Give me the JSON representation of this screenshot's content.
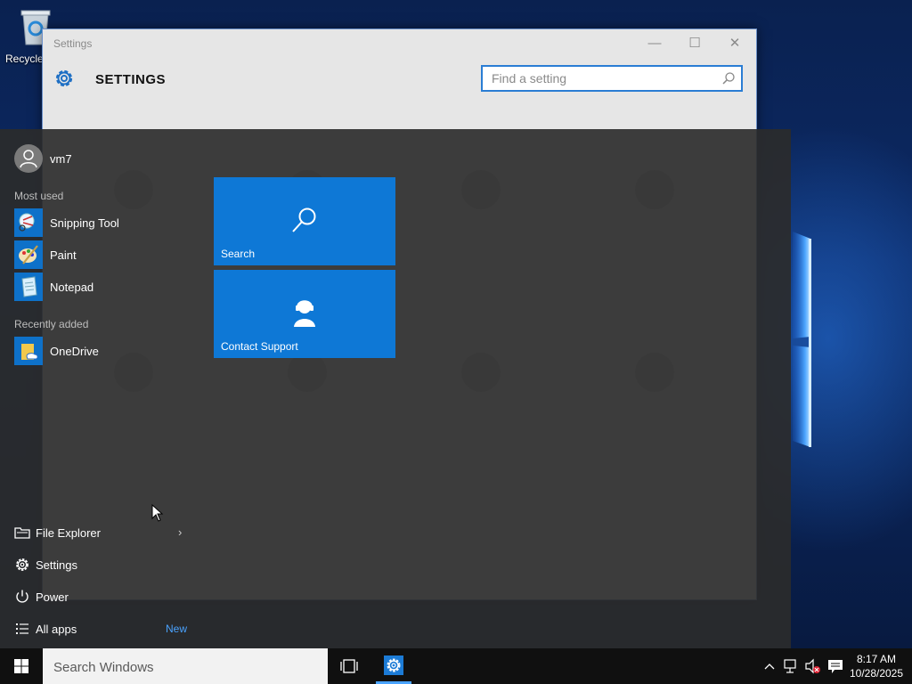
{
  "desktop": {
    "recycle_bin_label": "Recycle"
  },
  "settings_window": {
    "title": "Settings",
    "heading": "SETTINGS",
    "search_placeholder": "Find a setting"
  },
  "start_menu": {
    "user_name": "vm7",
    "most_used_label": "Most used",
    "most_used": [
      {
        "label": "Snipping Tool",
        "icon": "snipping-tool-icon"
      },
      {
        "label": "Paint",
        "icon": "paint-icon"
      },
      {
        "label": "Notepad",
        "icon": "notepad-icon"
      }
    ],
    "recently_added_label": "Recently added",
    "recently_added": [
      {
        "label": "OneDrive",
        "icon": "onedrive-icon"
      }
    ],
    "tiles": [
      {
        "label": "Search",
        "icon": "search-icon"
      },
      {
        "label": "Contact Support",
        "icon": "contact-support-icon"
      }
    ],
    "places": [
      {
        "label": "File Explorer",
        "icon": "file-explorer-icon"
      },
      {
        "label": "Settings",
        "icon": "gear-icon"
      },
      {
        "label": "Power",
        "icon": "power-icon"
      },
      {
        "label": "All apps",
        "icon": "all-apps-icon"
      }
    ],
    "all_apps_badge": "New"
  },
  "taskbar": {
    "search_placeholder": "Search Windows",
    "clock_time": "8:17 AM",
    "clock_date": "10/28/2025"
  },
  "colors": {
    "accent": "#0e78d6",
    "start_bg": "#2b2b2b",
    "taskbar_bg": "#101010"
  }
}
